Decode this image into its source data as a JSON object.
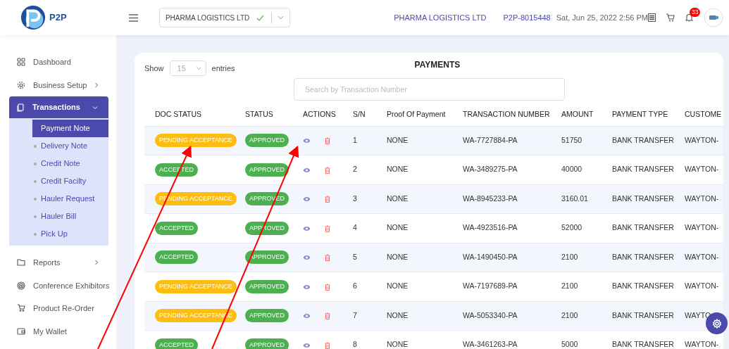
{
  "header": {
    "logo_text": "P2P",
    "company_select": {
      "value": "PHARMA LOGISTICS LTD"
    },
    "company_name": "PHARMA LOGISTICS LTD",
    "account_id": "P2P-8015448",
    "datetime": "Sat, Jun 25, 2022 2:56 PM",
    "notification_count": "33"
  },
  "sidebar": {
    "items": [
      {
        "label": "Dashboard",
        "arrow": false,
        "selected": false
      },
      {
        "label": "Business Setup",
        "arrow": true,
        "selected": false
      },
      {
        "label": "Transactions",
        "arrow": true,
        "selected": true,
        "expanded": true,
        "children": [
          {
            "label": "Payment Note",
            "selected": true
          },
          {
            "label": "Delivery Note",
            "selected": false
          },
          {
            "label": "Credit Note",
            "selected": false
          },
          {
            "label": "Credit Facilty",
            "selected": false
          },
          {
            "label": "Hauler Request",
            "selected": false
          },
          {
            "label": "Hauler Bill",
            "selected": false
          },
          {
            "label": "Pick Up",
            "selected": false
          }
        ]
      },
      {
        "label": "Reports",
        "arrow": true,
        "selected": false
      },
      {
        "label": "Conference Exhibitors",
        "arrow": false,
        "selected": false
      },
      {
        "label": "Product Re-Order",
        "arrow": false,
        "selected": false
      },
      {
        "label": "My Wallet",
        "arrow": false,
        "selected": false
      }
    ]
  },
  "payments": {
    "title": "PAYMENTS",
    "show_label": "Show",
    "page_size": "15",
    "entries_label": "entries",
    "search": {
      "placeholder": "Search by Transaction Number"
    },
    "table": {
      "columns": [
        "DOC STATUS",
        "STATUS",
        "ACTIONS",
        "S/N",
        "Proof Of Payment",
        "TRANSACTION NUMBER",
        "AMOUNT",
        "PAYMENT TYPE",
        "CUSTOME"
      ],
      "rows": [
        {
          "doc_status": {
            "text": "PENDING ACCEPTANCE",
            "color": "#fdbd11"
          },
          "status": "APPROVED",
          "sn": "1",
          "proof": "NONE",
          "transaction_number": "WA-7727884-PA",
          "amount": "51750",
          "payment_type": "BANK TRANSFER",
          "customer": "WAYTON-"
        },
        {
          "doc_status": {
            "text": "ACCEPTED",
            "color": "#4caf50"
          },
          "status": "APPROVED",
          "sn": "2",
          "proof": "NONE",
          "transaction_number": "WA-3489275-PA",
          "amount": "40000",
          "payment_type": "BANK TRANSFER",
          "customer": "WAYTON-"
        },
        {
          "doc_status": {
            "text": "PENDING ACCEPTANCE",
            "color": "#fdbd11"
          },
          "status": "APPROVED",
          "sn": "3",
          "proof": "NONE",
          "transaction_number": "WA-8945233-PA",
          "amount": "3160.01",
          "payment_type": "BANK TRANSFER",
          "customer": "WAYTON-"
        },
        {
          "doc_status": {
            "text": "ACCEPTED",
            "color": "#4caf50"
          },
          "status": "APPROVED",
          "sn": "4",
          "proof": "NONE",
          "transaction_number": "WA-4923516-PA",
          "amount": "52000",
          "payment_type": "BANK TRANSFER",
          "customer": "WAYTON-"
        },
        {
          "doc_status": {
            "text": "ACCEPTED",
            "color": "#4caf50"
          },
          "status": "APPROVED",
          "sn": "5",
          "proof": "NONE",
          "transaction_number": "WA-1490450-PA",
          "amount": "2100",
          "payment_type": "BANK TRANSFER",
          "customer": "WAYTON-"
        },
        {
          "doc_status": {
            "text": "PENDING ACCEPTANCE",
            "color": "#fdbd11"
          },
          "status": "APPROVED",
          "sn": "6",
          "proof": "NONE",
          "transaction_number": "WA-7197689-PA",
          "amount": "2100",
          "payment_type": "BANK TRANSFER",
          "customer": "WAYTON-"
        },
        {
          "doc_status": {
            "text": "PENDING ACCEPTANCE",
            "color": "#fdbd11"
          },
          "status": "APPROVED",
          "sn": "7",
          "proof": "NONE",
          "transaction_number": "WA-5053340-PA",
          "amount": "2100",
          "payment_type": "BANK TRANSFER",
          "customer": "WAYTO"
        },
        {
          "doc_status": {
            "text": "ACCEPTED",
            "color": "#4caf50"
          },
          "status": "APPROVED",
          "sn": "8",
          "proof": "NONE",
          "transaction_number": "WA-3461263-PA",
          "amount": "5000",
          "payment_type": "BANK TRANSFER",
          "customer": "WAYTON-"
        }
      ]
    }
  }
}
